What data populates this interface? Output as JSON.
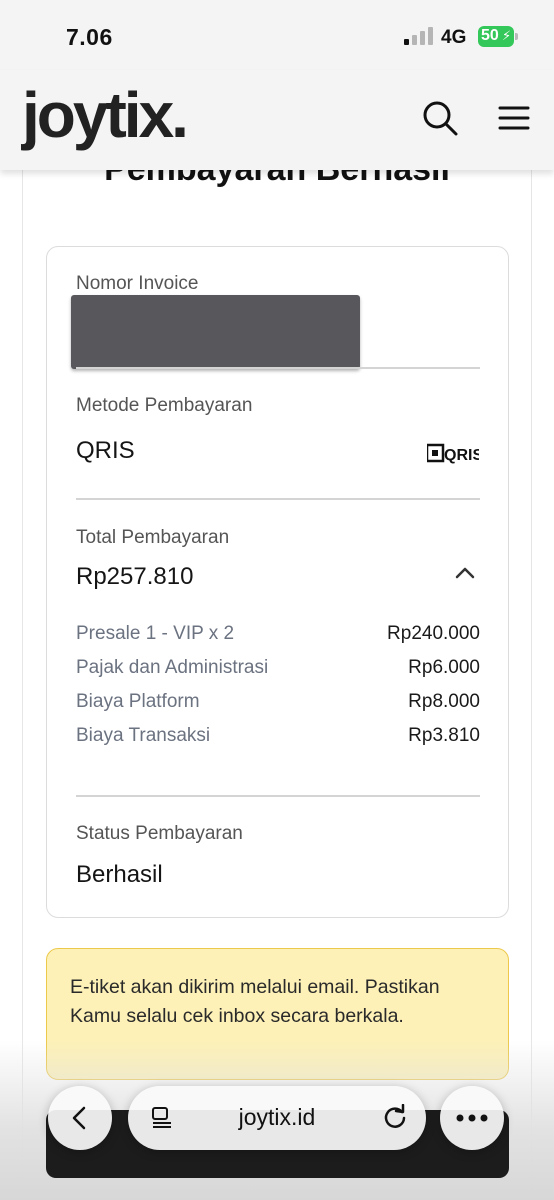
{
  "status_bar": {
    "time": "7.06",
    "network": "4G",
    "battery": "50"
  },
  "header": {
    "logo": "joytix."
  },
  "page": {
    "title": "Pembayaran Berhasil"
  },
  "invoice": {
    "label": "Nomor Invoice"
  },
  "payment_method": {
    "label": "Metode Pembayaran",
    "value": "QRIS",
    "logo_text": "QRIS"
  },
  "total": {
    "label": "Total Pembayaran",
    "value": "Rp257.810",
    "items": [
      {
        "name": "Presale 1 - VIP x 2",
        "amount": "Rp240.000"
      },
      {
        "name": "Pajak dan Administrasi",
        "amount": "Rp6.000"
      },
      {
        "name": "Biaya Platform",
        "amount": "Rp8.000"
      },
      {
        "name": "Biaya Transaksi",
        "amount": "Rp3.810"
      }
    ]
  },
  "status": {
    "label": "Status Pembayaran",
    "value": "Berhasil"
  },
  "notice": {
    "text": "E-tiket akan dikirim melalui email. Pastikan Kamu selalu cek inbox secara berkala."
  },
  "browser": {
    "url": "joytix.id"
  },
  "colors": {
    "notice_bg": "#fdf1b7",
    "notice_border": "#ecc94b",
    "battery": "#34c759"
  }
}
